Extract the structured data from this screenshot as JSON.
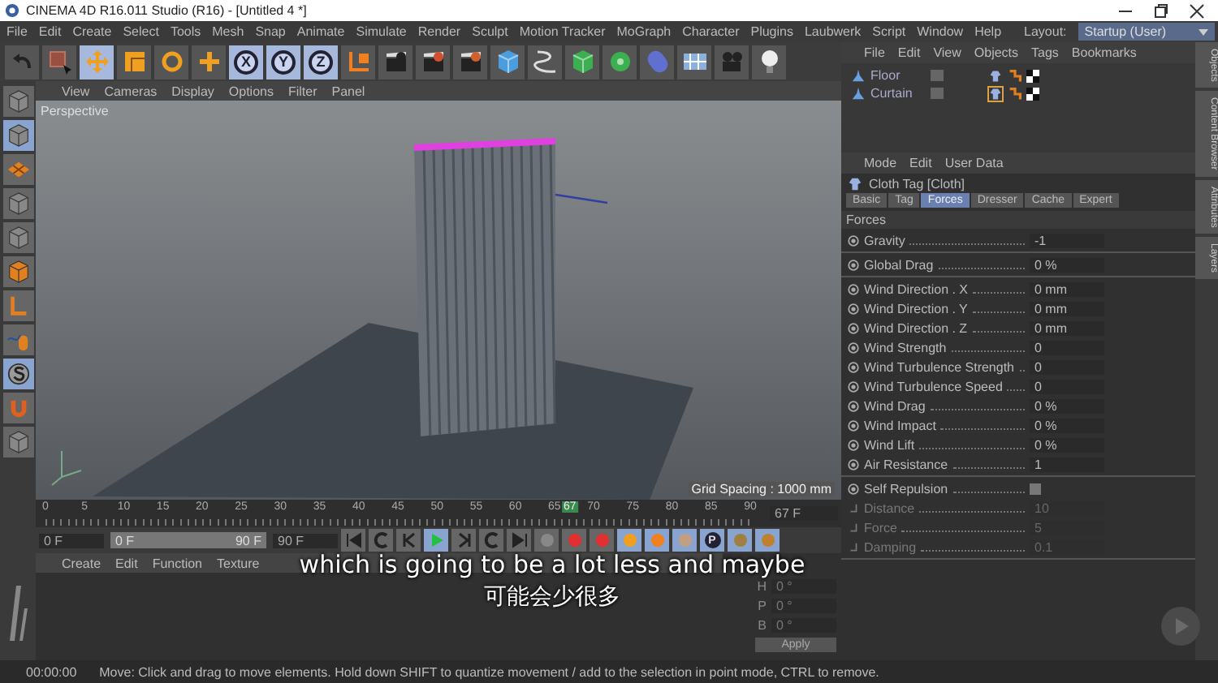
{
  "window": {
    "title": "CINEMA 4D R16.011 Studio (R16) - [Untitled 4 *]"
  },
  "menu": [
    "File",
    "Edit",
    "Create",
    "Select",
    "Tools",
    "Mesh",
    "Snap",
    "Animate",
    "Simulate",
    "Render",
    "Sculpt",
    "Motion Tracker",
    "MoGraph",
    "Character",
    "Plugins",
    "Laubwerk",
    "Script",
    "Window",
    "Help"
  ],
  "layout": {
    "label": "Layout:",
    "value": "Startup (User)"
  },
  "toolbar": [
    {
      "kind": "icon",
      "selected": false
    },
    {
      "kind": "icon",
      "selected": false
    },
    {
      "kind": "icon",
      "selected": true
    },
    {
      "kind": "icon",
      "selected": false
    },
    {
      "kind": "icon",
      "selected": false
    },
    {
      "kind": "icon",
      "selected": false
    },
    {
      "kind": "axis",
      "label": "X",
      "selected": true
    },
    {
      "kind": "axis",
      "label": "Y",
      "selected": true
    },
    {
      "kind": "axis",
      "label": "Z",
      "selected": true
    },
    {
      "kind": "icon",
      "selected": false
    },
    {
      "kind": "icon",
      "selected": false
    },
    {
      "kind": "icon",
      "selected": false
    },
    {
      "kind": "icon",
      "selected": false
    },
    {
      "kind": "icon",
      "selected": false
    },
    {
      "kind": "icon",
      "selected": false
    },
    {
      "kind": "icon",
      "selected": false
    },
    {
      "kind": "icon",
      "selected": false
    },
    {
      "kind": "icon",
      "selected": false
    },
    {
      "kind": "icon",
      "selected": false
    },
    {
      "kind": "icon",
      "selected": false
    },
    {
      "kind": "icon",
      "selected": false
    }
  ],
  "side_tools": [
    {
      "selected": false
    },
    {
      "selected": true
    },
    {
      "selected": false
    },
    {
      "selected": false
    },
    {
      "selected": false
    },
    {
      "selected": false
    },
    {
      "selected": false
    },
    {
      "selected": false
    },
    {
      "selected": true
    },
    {
      "selected": false
    },
    {
      "selected": false
    }
  ],
  "viewport": {
    "menu": [
      "View",
      "Cameras",
      "Display",
      "Options",
      "Filter",
      "Panel"
    ],
    "camera": "Perspective",
    "grid": "Grid Spacing : 1000 mm"
  },
  "timeline": {
    "ticks": [
      "0",
      "5",
      "10",
      "15",
      "20",
      "25",
      "30",
      "35",
      "40",
      "45",
      "50",
      "55",
      "60",
      "65",
      "70",
      "75",
      "80",
      "85",
      "90"
    ],
    "current": "67",
    "level": 0.744,
    "frame_field": "67 F"
  },
  "range": {
    "level": 1,
    "start": "0 F",
    "slider_start": "0 F",
    "slider_end": "90 F",
    "end": "90 F"
  },
  "playback": [
    {
      "selected": false
    },
    {
      "selected": false
    },
    {
      "selected": false
    },
    {
      "selected": true
    },
    {
      "selected": false
    },
    {
      "selected": false
    },
    {
      "selected": false
    }
  ],
  "keys": [
    {
      "kind": "icon",
      "selected": false
    },
    {
      "kind": "icon",
      "selected": false
    },
    {
      "kind": "icon",
      "selected": false
    },
    {
      "kind": "icon",
      "selected": true
    },
    {
      "kind": "icon",
      "selected": true
    },
    {
      "kind": "icon",
      "selected": true
    },
    {
      "kind": "letter",
      "label": "P",
      "selected": true
    },
    {
      "kind": "icon",
      "selected": true
    },
    {
      "kind": "icon",
      "selected": true
    }
  ],
  "materials": {
    "menu": [
      "Create",
      "Edit",
      "Function",
      "Texture"
    ]
  },
  "coordinates": {
    "rows": [
      {
        "label": "H",
        "value": "0 °"
      },
      {
        "label": "P",
        "value": "0 °"
      },
      {
        "label": "B",
        "value": "0 °"
      }
    ],
    "apply": "Apply"
  },
  "objects": {
    "menu": [
      "File",
      "Edit",
      "View",
      "Objects",
      "Tags",
      "Bookmarks"
    ],
    "items": [
      {
        "name": "Floor",
        "selected": false
      },
      {
        "name": "Curtain",
        "selected": true
      }
    ]
  },
  "attributes": {
    "menu": [
      "Mode",
      "Edit",
      "User Data"
    ],
    "title": "Cloth Tag [Cloth]",
    "tabs": [
      {
        "label": "Basic",
        "selected": false
      },
      {
        "label": "Tag",
        "selected": false
      },
      {
        "label": "Forces",
        "selected": true
      },
      {
        "label": "Dresser",
        "selected": false
      },
      {
        "label": "Cache",
        "selected": false
      },
      {
        "label": "Expert",
        "selected": false
      }
    ],
    "section": "Forces",
    "groups": [
      [
        {
          "kind": "field",
          "label": "Gravity",
          "value": "-1",
          "disabled": false
        }
      ],
      [
        {
          "kind": "field",
          "label": "Global Drag",
          "value": "0 %",
          "disabled": false
        }
      ],
      [
        {
          "kind": "field",
          "label": "Wind Direction . X",
          "value": "0 mm",
          "disabled": false
        },
        {
          "kind": "field",
          "label": "Wind Direction . Y",
          "value": "0 mm",
          "disabled": false
        },
        {
          "kind": "field",
          "label": "Wind Direction . Z",
          "value": "0 mm",
          "disabled": false
        },
        {
          "kind": "field",
          "label": "Wind Strength",
          "value": "0",
          "disabled": false
        },
        {
          "kind": "field",
          "label": "Wind Turbulence Strength",
          "value": "0",
          "disabled": false
        },
        {
          "kind": "field",
          "label": "Wind Turbulence Speed",
          "value": "0",
          "disabled": false
        },
        {
          "kind": "field",
          "label": "Wind Drag",
          "value": "0 %",
          "disabled": false
        },
        {
          "kind": "field",
          "label": "Wind Impact",
          "value": "0 %",
          "disabled": false
        },
        {
          "kind": "field",
          "label": "Wind Lift",
          "value": "0 %",
          "disabled": false
        },
        {
          "kind": "field",
          "label": "Air Resistance",
          "value": "1",
          "disabled": false
        }
      ],
      [
        {
          "kind": "checkbox",
          "label": "Self Repulsion",
          "checked": false,
          "disabled": false
        },
        {
          "kind": "field",
          "label": "Distance",
          "value": "10",
          "disabled": true
        },
        {
          "kind": "field",
          "label": "Force",
          "value": "5",
          "disabled": true
        },
        {
          "kind": "field",
          "label": "Damping",
          "value": "0.1",
          "disabled": true
        }
      ]
    ]
  },
  "side_tabs": [
    "Objects",
    "Content Browser",
    "Attributes",
    "Layers"
  ],
  "status_bar": {
    "time": "00:00:00",
    "message": "Move: Click and drag to move elements. Hold down SHIFT to quantize movement / add to the selection in point mode, CTRL to remove."
  },
  "subtitles": [
    "which is going to be a lot less and maybe",
    "可能会少很多"
  ]
}
